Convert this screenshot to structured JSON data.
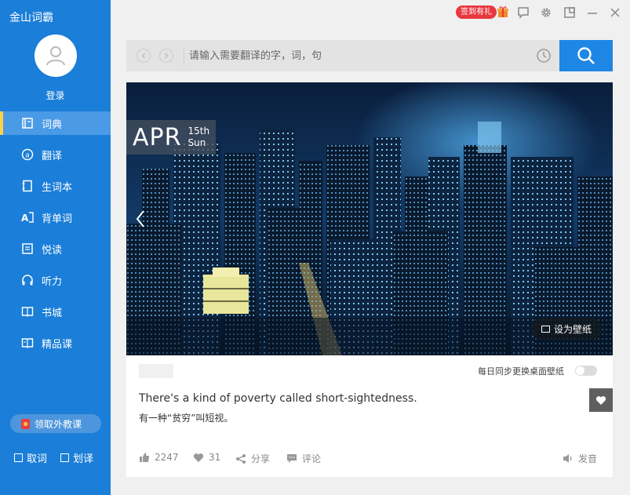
{
  "sidebar": {
    "app_title": "金山词霸",
    "login": "登录",
    "items": [
      {
        "label": "词典",
        "icon": "dictionary-icon",
        "active": true
      },
      {
        "label": "翻译",
        "icon": "translate-icon"
      },
      {
        "label": "生词本",
        "icon": "wordbook-icon"
      },
      {
        "label": "背单词",
        "icon": "memorize-words-icon"
      },
      {
        "label": "悦读",
        "icon": "reading-icon"
      },
      {
        "label": "听力",
        "icon": "headphones-icon"
      },
      {
        "label": "书城",
        "icon": "bookstore-icon"
      },
      {
        "label": "精品课",
        "icon": "courses-icon"
      }
    ],
    "coupon": "领取外教课",
    "take_word": "取词",
    "select_translate": "划译"
  },
  "titlebar": {
    "signin_badge": "签到有礼"
  },
  "search": {
    "placeholder": "请输入需要翻译的字，词，句"
  },
  "daily": {
    "month": "APR",
    "day": "15th",
    "weekday": "Sun",
    "set_wallpaper": "设为壁纸",
    "sync_label": "每日同步更换桌面壁纸",
    "sentence_en": "There's a kind of poverty called short-sightedness.",
    "sentence_zh": "有一种“贫穷”叫短视。",
    "likes": "2247",
    "hearts": "31",
    "share": "分享",
    "comment": "评论",
    "pronounce": "发音"
  },
  "colors": {
    "sidebar_bg": "#1b7ed8",
    "accent_blue": "#1e87e5",
    "badge_red": "#e8373f"
  }
}
